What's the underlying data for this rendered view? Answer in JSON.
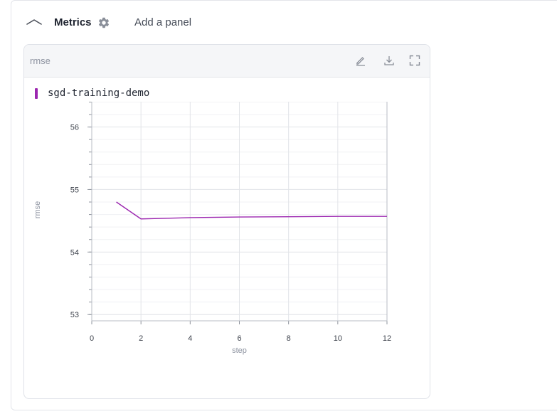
{
  "section": {
    "title": "Metrics",
    "add_panel_label": "Add a panel",
    "collapse_icon": "chevron-up-icon",
    "settings_icon": "gear-icon"
  },
  "panel": {
    "title": "rmse",
    "actions": [
      {
        "name": "edit",
        "icon": "pencil-icon"
      },
      {
        "name": "download",
        "icon": "download-icon"
      },
      {
        "name": "fullscreen",
        "icon": "expand-icon"
      }
    ]
  },
  "legend": {
    "series_name": "sgd-training-demo",
    "color": "#9c27b0"
  },
  "chart_data": {
    "type": "line",
    "xlabel": "step",
    "ylabel": "rmse",
    "xlim": [
      0,
      12
    ],
    "ylim": [
      52.9,
      56.45
    ],
    "x_ticks": [
      0,
      2,
      4,
      6,
      8,
      10,
      12
    ],
    "y_ticks": [
      53,
      54,
      55,
      56,
      56.45
    ],
    "grid": true,
    "series": [
      {
        "name": "sgd-training-demo",
        "color": "#9c27b0",
        "x": [
          1,
          2,
          4,
          6,
          8,
          10,
          12
        ],
        "y": [
          54.8,
          54.53,
          54.55,
          54.56,
          54.565,
          54.57,
          54.57
        ]
      }
    ]
  }
}
